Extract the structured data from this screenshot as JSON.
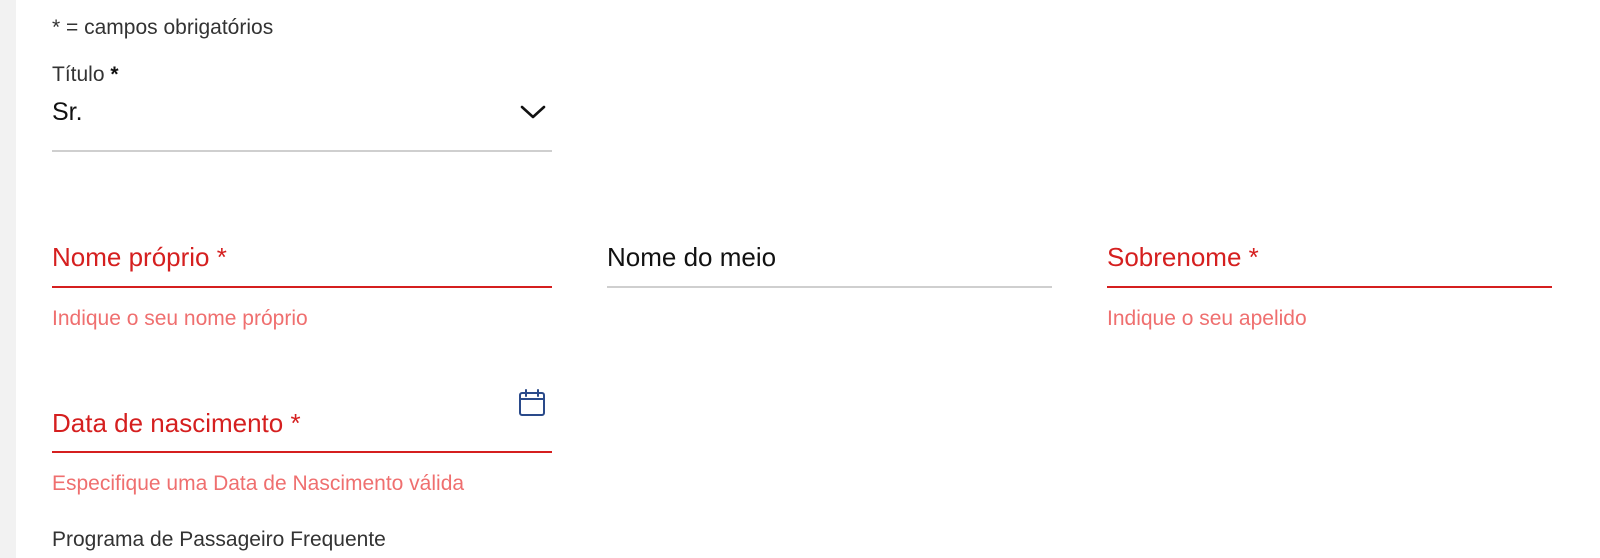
{
  "form": {
    "required_note": "* = campos obrigatórios",
    "title_field": {
      "label": "Título",
      "required_mark": "*",
      "value": "Sr."
    },
    "first_name": {
      "label": "Nome próprio *",
      "error": "Indique o seu nome próprio"
    },
    "middle_name": {
      "label": "Nome do meio"
    },
    "last_name": {
      "label": "Sobrenome *",
      "error": "Indique o seu apelido"
    },
    "birth_date": {
      "label": "Data de nascimento *",
      "error": "Especifique uma Data de Nascimento válida",
      "icon": "calendar-icon"
    },
    "frequent_flyer": {
      "label": "Programa de Passageiro Frequente"
    }
  },
  "colors": {
    "error": "#d51f1f",
    "error_message": "#ef6f6f",
    "icon": "#2a4a8a"
  }
}
